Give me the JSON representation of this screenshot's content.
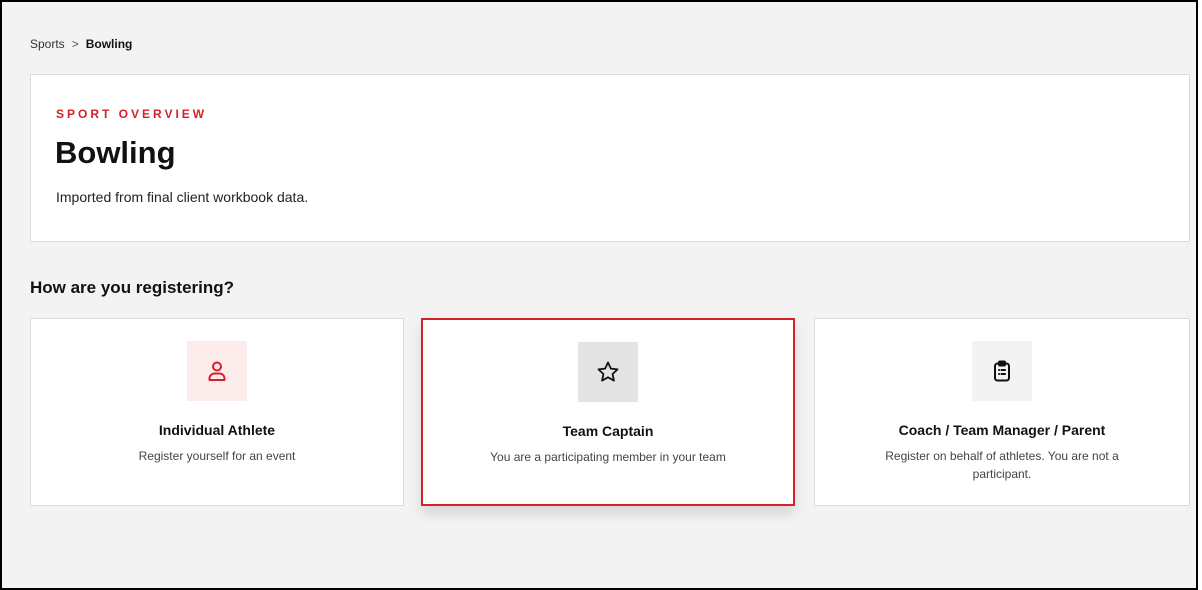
{
  "breadcrumb": {
    "parent": "Sports",
    "separator": ">",
    "current": "Bowling"
  },
  "overview": {
    "eyebrow": "SPORT OVERVIEW",
    "title": "Bowling",
    "description": "Imported from final client workbook data."
  },
  "registration": {
    "question": "How are you registering?",
    "options": [
      {
        "icon": "person-icon",
        "title": "Individual Athlete",
        "description": "Register yourself for an event",
        "icon_bg": "#fdecec",
        "icon_color": "#d4222a",
        "selected": false
      },
      {
        "icon": "star-icon",
        "title": "Team Captain",
        "description": "You are a participating member in your team",
        "icon_bg": "#e3e3e3",
        "icon_color": "#111111",
        "selected": true
      },
      {
        "icon": "clipboard-icon",
        "title": "Coach / Team Manager / Parent",
        "description": "Register on behalf of athletes. You are not a participant.",
        "icon_bg": "#f3f3f3",
        "icon_color": "#111111",
        "selected": false
      }
    ]
  },
  "colors": {
    "accent": "#d4222a",
    "page_bg": "#f3f3f3",
    "card_bg": "#ffffff"
  }
}
